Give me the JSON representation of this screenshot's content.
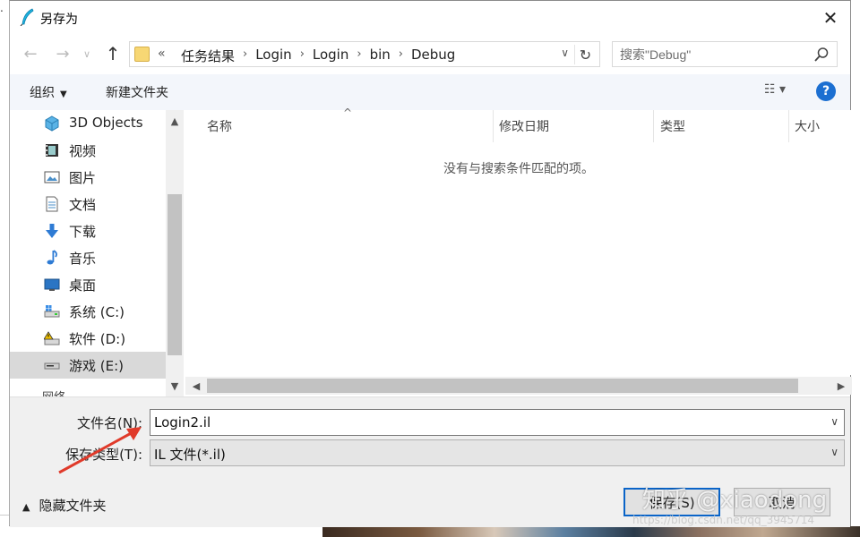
{
  "window": {
    "title": "另存为"
  },
  "nav": {
    "back": "←",
    "forward": "→",
    "recent": "∨",
    "up": "↑"
  },
  "address": {
    "overflow": "«",
    "crumbs": [
      "任务结果",
      "Login",
      "Login",
      "bin",
      "Debug"
    ],
    "separator": "›"
  },
  "search": {
    "placeholder": "搜索\"Debug\""
  },
  "toolbar": {
    "organize": "组织",
    "new_folder": "新建文件夹",
    "view": "☷ ▾",
    "help": "?"
  },
  "sidebar": {
    "items": [
      {
        "label": "3D Objects",
        "icon": "3d-objects-icon"
      },
      {
        "label": "视频",
        "icon": "video-icon"
      },
      {
        "label": "图片",
        "icon": "pictures-icon"
      },
      {
        "label": "文档",
        "icon": "documents-icon"
      },
      {
        "label": "下载",
        "icon": "download-icon"
      },
      {
        "label": "音乐",
        "icon": "music-icon"
      },
      {
        "label": "桌面",
        "icon": "desktop-icon"
      },
      {
        "label": "系统 (C:)",
        "icon": "drive-c-icon"
      },
      {
        "label": "软件 (D:)",
        "icon": "drive-d-icon"
      },
      {
        "label": "游戏 (E:)",
        "icon": "drive-e-icon"
      }
    ],
    "selected_index": 9,
    "cut_item": "网络"
  },
  "filelist": {
    "columns": [
      "名称",
      "修改日期",
      "类型",
      "大小"
    ],
    "empty_message": "没有与搜索条件匹配的项。"
  },
  "form": {
    "filename_label": "文件名(N):",
    "filename_value": "Login2.il",
    "filetype_label": "保存类型(T):",
    "filetype_value": "IL 文件(*.il)"
  },
  "footer": {
    "hide_folders": "隐藏文件夹",
    "save": "保存(S)",
    "cancel": "取消"
  },
  "overlay": {
    "watermark": "知乎 @xiaodong",
    "url": "https://blog.csdn.net/qq_3945714"
  },
  "colors": {
    "accent": "#0a64c8",
    "help": "#1c6fd1",
    "annotation": "#e03a2a",
    "folder": "#f7d774"
  }
}
